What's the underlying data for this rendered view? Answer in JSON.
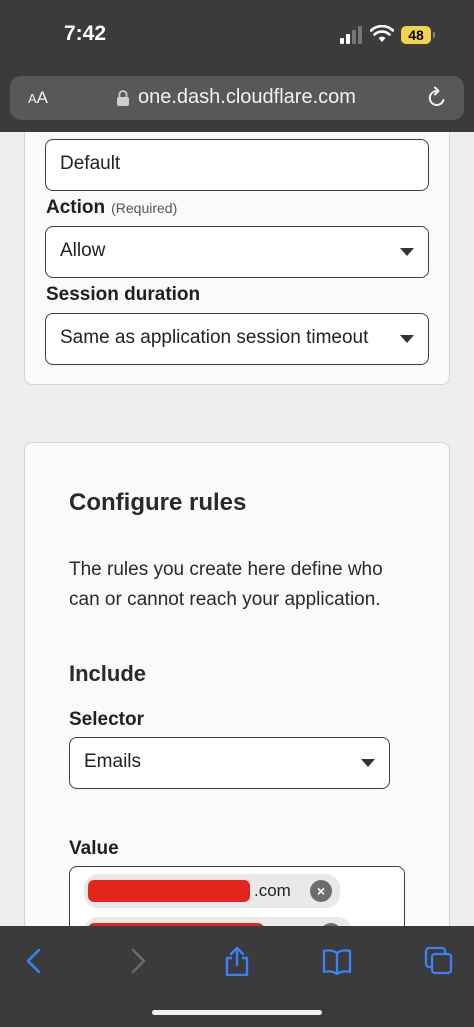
{
  "status_bar": {
    "time": "7:42",
    "battery": "48"
  },
  "browser": {
    "aa_big": "A",
    "aa_small": "A",
    "url": "one.dash.cloudflare.com"
  },
  "policy_card": {
    "name_value": "Default",
    "action_label": "Action",
    "action_required": "(Required)",
    "action_value": "Allow",
    "session_label": "Session duration",
    "session_value": "Same as application session timeout"
  },
  "rules_card": {
    "title": "Configure rules",
    "description": "The rules you create here define who can or cannot reach your application.",
    "include_heading": "Include",
    "selector_label": "Selector",
    "selector_value": "Emails",
    "value_label": "Value",
    "values": [
      {
        "visible_suffix": ".com",
        "redacted": true
      },
      {
        "visible_suffix": "",
        "redacted": true
      }
    ]
  },
  "colors": {
    "status_bar_bg": "#3b3b3d",
    "battery_fill": "#f3d34a",
    "redaction": "#e3261b",
    "toolbar_icon_active": "#3b82f6",
    "toolbar_icon_disabled": "#6a6a6e"
  },
  "icons": {
    "status": [
      "signal-icon",
      "wifi-icon",
      "battery-icon"
    ],
    "url_bar": [
      "lock-icon",
      "reload-icon"
    ],
    "toolbar": [
      "back-icon",
      "forward-icon",
      "share-icon",
      "bookmarks-icon",
      "tabs-icon"
    ]
  }
}
